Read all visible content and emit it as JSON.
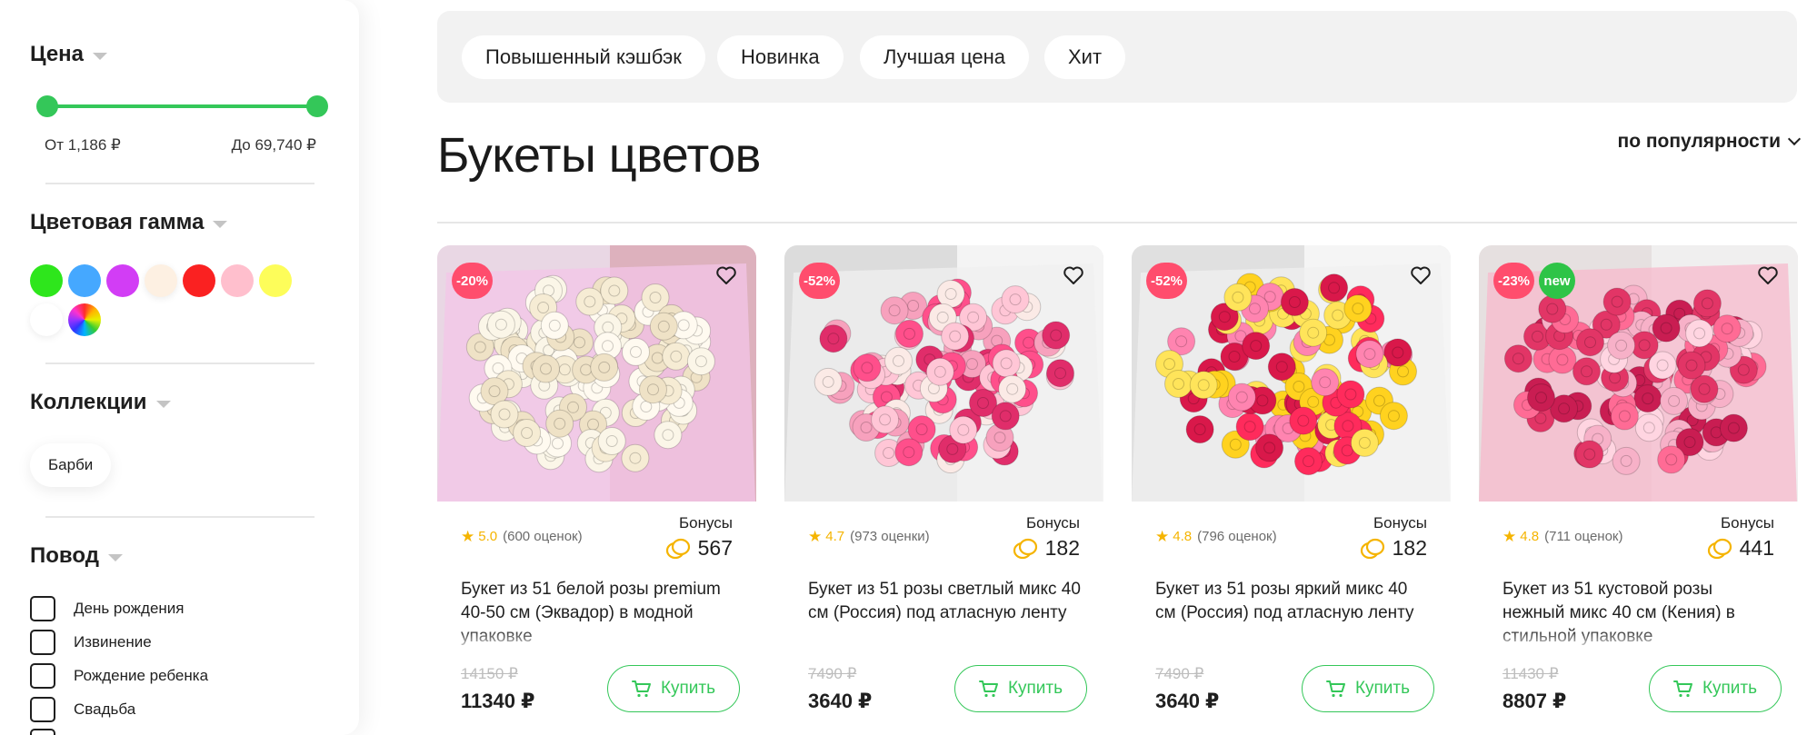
{
  "sidebar": {
    "price_filter": {
      "title": "Цена",
      "from_label": "От 1,186 ₽",
      "to_label": "До 69,740 ₽"
    },
    "color_filter": {
      "title": "Цветовая гамма",
      "swatches": [
        "#2ee61c",
        "#45a8ff",
        "#d23df5",
        "#fdf0e2",
        "#fa2121",
        "#ffbfcd",
        "#fdfd5a",
        "#ffffff",
        "multicolor"
      ]
    },
    "collections_filter": {
      "title": "Коллекции",
      "items": [
        "Барби"
      ]
    },
    "occasion_filter": {
      "title": "Повод",
      "options": [
        "День рождения",
        "Извинение",
        "Рождение ребенка",
        "Свадьба"
      ]
    }
  },
  "tags": [
    "Повышенный кэшбэк",
    "Новинка",
    "Лучшая цена",
    "Хит"
  ],
  "page_title": "Букеты цветов",
  "sort": {
    "label": "по популярности"
  },
  "colors": {
    "accent": "#34c759",
    "sale_badge": "#ff4d6d",
    "new_badge": "#2ec447",
    "star": "#f5b400"
  },
  "products": [
    {
      "badges": [
        "-20%"
      ],
      "rating": "5.0",
      "reviews": "(600 оценок)",
      "bonus_label": "Бонусы",
      "bonus": "567",
      "name": "Букет из 51 белой розы premium 40-50 см (Эквадор) в модной упаковке",
      "old_price": "14150 ₽",
      "price": "11340 ₽",
      "buy_label": "Купить"
    },
    {
      "badges": [
        "-52%"
      ],
      "rating": "4.7",
      "reviews": "(973 оценки)",
      "bonus_label": "Бонусы",
      "bonus": "182",
      "name": "Букет из 51 розы светлый микс 40 см (Россия) под атласную ленту",
      "old_price": "7490 ₽",
      "price": "3640 ₽",
      "buy_label": "Купить"
    },
    {
      "badges": [
        "-52%"
      ],
      "rating": "4.8",
      "reviews": "(796 оценок)",
      "bonus_label": "Бонусы",
      "bonus": "182",
      "name": "Букет из 51 розы яркий микс 40 см (Россия) под атласную ленту",
      "old_price": "7490 ₽",
      "price": "3640 ₽",
      "buy_label": "Купить"
    },
    {
      "badges": [
        "-23%",
        "new"
      ],
      "rating": "4.8",
      "reviews": "(711 оценок)",
      "bonus_label": "Бонусы",
      "bonus": "441",
      "name": "Букет из 51 кустовой розы нежный микс 40 см (Кения) в стильной упаковке",
      "old_price": "11430 ₽",
      "price": "8807 ₽",
      "buy_label": "Купить"
    }
  ]
}
